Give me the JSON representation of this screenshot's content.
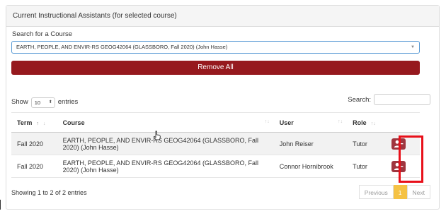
{
  "panel": {
    "title": "Current Instructional Assistants (for selected course)"
  },
  "search_course": {
    "label": "Search for a Course",
    "selected": "EARTH, PEOPLE, AND ENVIR-RS GEOG42064 (GLASSBORO, Fall 2020) (John Hasse)"
  },
  "remove_all_label": "Remove All",
  "length": {
    "show": "Show",
    "value": "10",
    "entries": "entries"
  },
  "search": {
    "label": "Search:",
    "value": ""
  },
  "table": {
    "headers": {
      "term": "Term",
      "course": "Course",
      "user": "User",
      "role": "Role"
    },
    "rows": [
      {
        "term": "Fall 2020",
        "course": "EARTH, PEOPLE, AND ENVIR-RS GEOG42064 (GLASSBORO, Fall 2020) (John Hasse)",
        "user": "John Reiser",
        "role": "Tutor"
      },
      {
        "term": "Fall 2020",
        "course": "EARTH, PEOPLE, AND ENVIR-RS GEOG42064 (GLASSBORO, Fall 2020) (John Hasse)",
        "user": "Connor Hornibrook",
        "role": "Tutor"
      }
    ]
  },
  "info": "Showing 1 to 2 of 2 entries",
  "pagination": {
    "previous": "Previous",
    "page": "1",
    "next": "Next"
  },
  "colors": {
    "primary": "#96191e",
    "action": "#a0353f",
    "highlight": "#e8101a",
    "page_active": "#f5c244",
    "focus": "#5b9bd5"
  },
  "icons": {
    "row_action": "remove-user-icon",
    "sort": "sort-arrows-icon",
    "select": "chevron-down-icon"
  }
}
